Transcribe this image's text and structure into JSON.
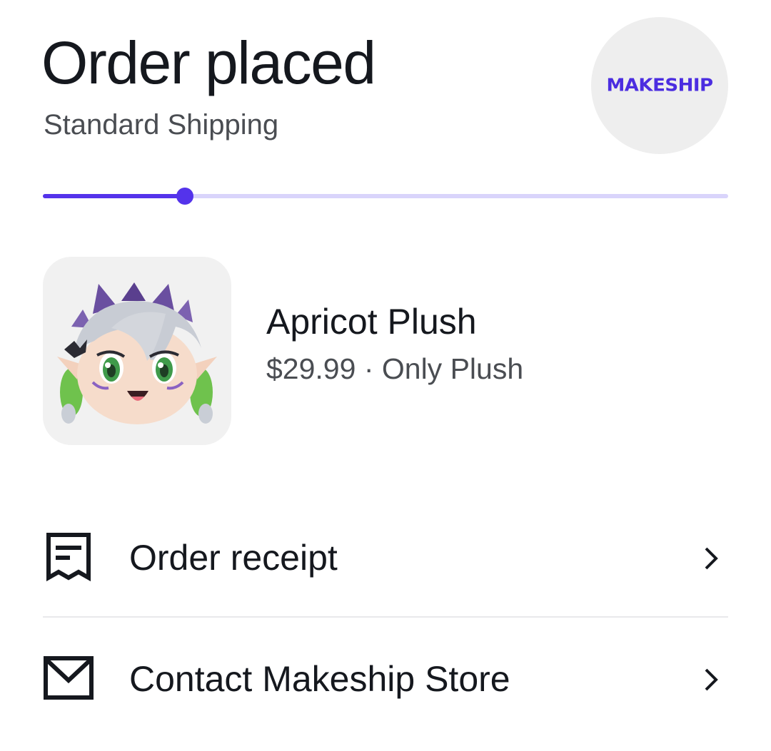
{
  "header": {
    "title": "Order placed",
    "shipping_method": "Standard Shipping"
  },
  "store_logo": {
    "text": "MAKESHIP",
    "color": "#4b2de0"
  },
  "progress": {
    "fraction": 0.207,
    "fill_color": "#5433eb",
    "track_color": "#d9d4fb"
  },
  "product": {
    "name": "Apricot Plush",
    "price": "$29.99",
    "separator": "·",
    "variant": "Only Plush",
    "image_icon": "plush-character-image"
  },
  "actions": [
    {
      "label": "Order receipt",
      "icon": "receipt-icon"
    },
    {
      "label": "Contact Makeship Store",
      "icon": "mail-icon"
    }
  ]
}
